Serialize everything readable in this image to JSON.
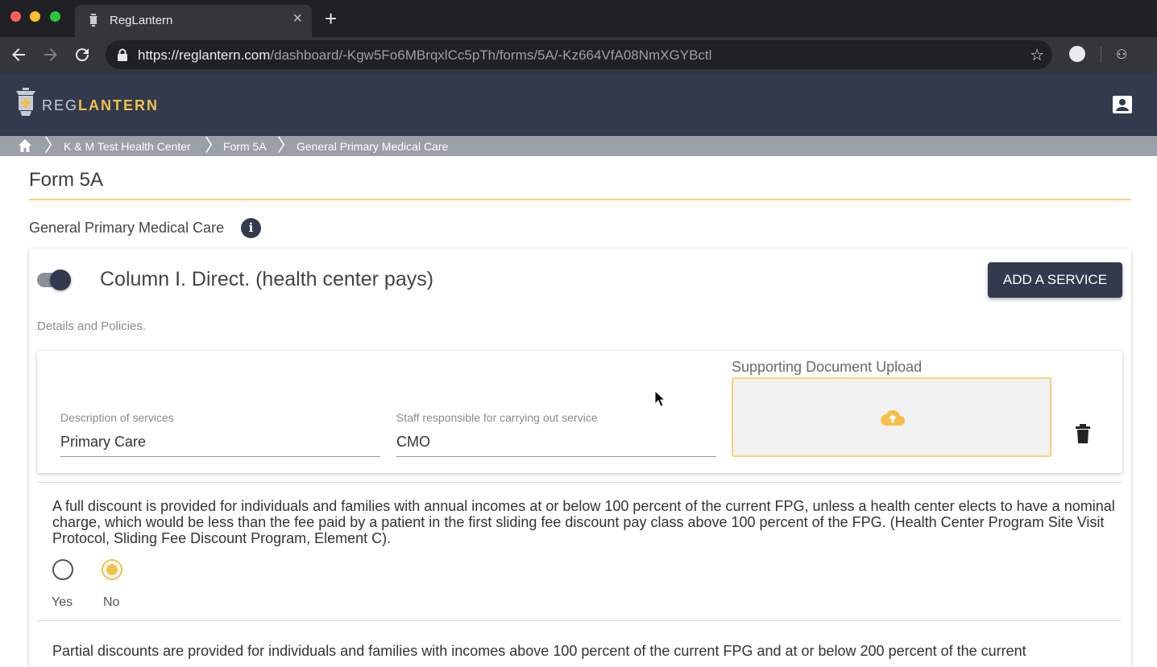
{
  "browser": {
    "tab_title": "RegLantern",
    "url_host": "https://reglantern.com",
    "url_path": "/dashboard/-Kgw5Fo6MBrqxlCc5pTh/forms/5A/-Kz664VfA08NmXGYBctl"
  },
  "app": {
    "logo_part1": "REG",
    "logo_part2": "LANTERN"
  },
  "breadcrumb": {
    "items": [
      "K & M Test Health Center",
      "Form 5A",
      "General Primary Medical Care"
    ]
  },
  "page": {
    "title": "Form 5A",
    "section_title": "General Primary Medical Care",
    "info_glyph": "i"
  },
  "card": {
    "column_title": "Column I. Direct. (health center pays)",
    "toggle_on": true,
    "add_button": "ADD A SERVICE",
    "details_label": "Details and Policies.",
    "service": {
      "description_label": "Description of services",
      "description_value": "Primary Care",
      "staff_label": "Staff responsible for carrying out service",
      "staff_value": "CMO",
      "upload_label": "Supporting Document Upload"
    },
    "policy_question": "A full discount is provided for individuals and families with annual incomes at or below 100 percent of the current FPG, unless a health center elects to have a nominal charge, which would be less than the fee paid by a patient in the first sliding fee discount pay class above 100 percent of the FPG. (Health Center Program Site Visit Protocol, Sliding Fee Discount Program, Element C).",
    "radio_yes": "Yes",
    "radio_no": "No",
    "selected": "No",
    "next_question_partial": "Partial discounts are provided for individuals and families with incomes above 100 percent of the current FPG and at or below 200 percent of the current"
  },
  "colors": {
    "navy": "#333a4d",
    "gold": "#f5c04a"
  }
}
